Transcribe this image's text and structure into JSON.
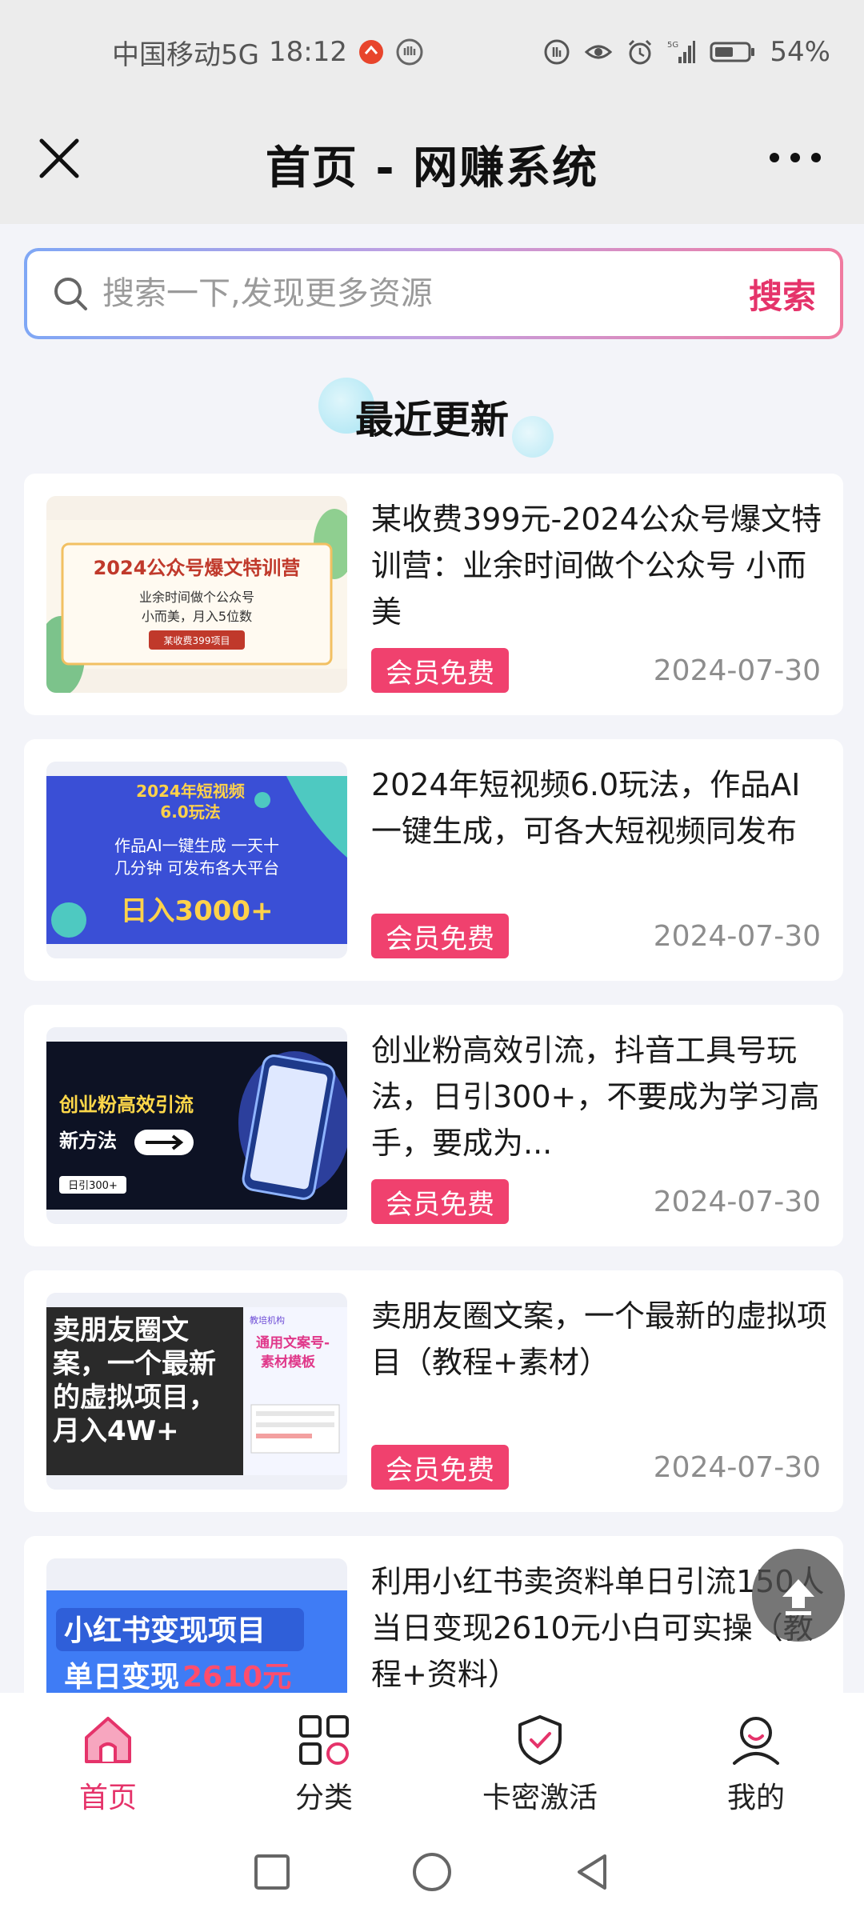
{
  "status_bar": {
    "carrier": "中国移动5G",
    "time": "18:12",
    "battery": "54%"
  },
  "nav": {
    "title": "首页 - 网赚系统"
  },
  "search": {
    "placeholder": "搜索一下,发现更多资源",
    "button": "搜索"
  },
  "section": {
    "title": "最近更新"
  },
  "items": [
    {
      "title": "某收费399元-2024公众号爆文特训营：业余时间做个公众号 小而美",
      "badge": "会员免费",
      "date": "2024-07-30",
      "thumb": {
        "line1": "2024公众号爆文特训营",
        "line2": "业余时间做个公众号",
        "line3": "小而美，月入5位数",
        "line4": "某收费399项目"
      }
    },
    {
      "title": "2024年短视频6.0玩法，作品AI一键生成，可各大短视频同发布",
      "badge": "会员免费",
      "date": "2024-07-30",
      "thumb": {
        "line1": "2024年短视频",
        "line2": "6.0玩法",
        "line3": "作品AI一键生成   一天十",
        "line4": "几分钟 可发布各大平台",
        "line5": "日入3000+"
      }
    },
    {
      "title": "创业粉高效引流，抖音工具号玩法，日引300+，不要成为学习高手，要成为...",
      "badge": "会员免费",
      "date": "2024-07-30",
      "thumb": {
        "line1": "创业粉高效引流",
        "line2": "新方法",
        "line3": "日引300+"
      }
    },
    {
      "title": "卖朋友圈文案，一个最新的虚拟项目（教程+素材）",
      "badge": "会员免费",
      "date": "2024-07-30",
      "thumb": {
        "line1": "卖朋友圈文",
        "line2": "案，一个最新",
        "line3": "的虚拟项目，",
        "line4": "月入4W+",
        "line5": "通用文案号-",
        "line6": "素材模板",
        "line7": "教培机构"
      }
    },
    {
      "title": "利用小红书卖资料单日引流150人当日变现2610元小白可实操（教程+资料）",
      "thumb": {
        "line1": "小红书变现项目",
        "line2": "单日变现",
        "line3": "2610元"
      }
    }
  ],
  "tabs": [
    {
      "label": "首页",
      "icon": "home-icon"
    },
    {
      "label": "分类",
      "icon": "category-icon"
    },
    {
      "label": "卡密激活",
      "icon": "shield-check-icon"
    },
    {
      "label": "我的",
      "icon": "user-icon"
    }
  ],
  "colors": {
    "accent": "#e5336a",
    "badge": "#f0416e"
  }
}
